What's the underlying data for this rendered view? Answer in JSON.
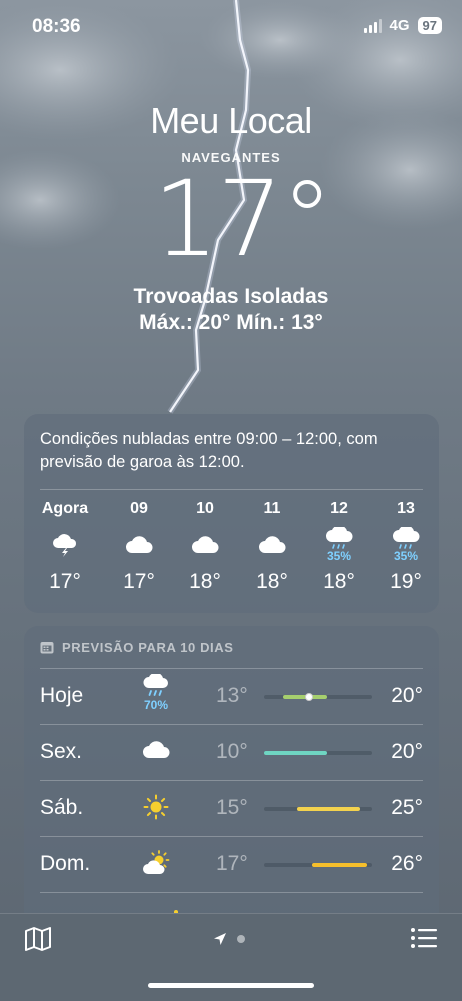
{
  "status": {
    "time": "08:36",
    "network": "4G",
    "battery": "97"
  },
  "location": {
    "title": "Meu Local",
    "city": "NAVEGANTES"
  },
  "current": {
    "temperature": "17°",
    "condition": "Trovoadas Isoladas",
    "hilo": "Máx.: 20°  Mín.: 13°"
  },
  "hourly": {
    "summary": "Condições nubladas entre 09:00 – 12:00, com previsão de garoa às 12:00.",
    "items": [
      {
        "label": "Agora",
        "icon": "thunder-cloud-icon",
        "precip": "",
        "temp": "17°"
      },
      {
        "label": "09",
        "icon": "cloud-icon",
        "precip": "",
        "temp": "17°"
      },
      {
        "label": "10",
        "icon": "cloud-icon",
        "precip": "",
        "temp": "18°"
      },
      {
        "label": "11",
        "icon": "cloud-icon",
        "precip": "",
        "temp": "18°"
      },
      {
        "label": "12",
        "icon": "drizzle-icon",
        "precip": "35%",
        "temp": "18°"
      },
      {
        "label": "13",
        "icon": "drizzle-icon",
        "precip": "35%",
        "temp": "19°"
      }
    ]
  },
  "daily": {
    "header": "PREVISÃO PARA 10 DIAS",
    "rows": [
      {
        "day": "Hoje",
        "icon": "rain-cloud-icon",
        "precip": "70%",
        "low": "13°",
        "high": "20°",
        "range_start": 0.18,
        "range_end": 0.58,
        "current_pos": 0.41,
        "bar_color": "#a6cf6e"
      },
      {
        "day": "Sex.",
        "icon": "cloud-icon",
        "precip": "",
        "low": "10°",
        "high": "20°",
        "range_start": 0.0,
        "range_end": 0.58,
        "bar_color": "#6fd5c2"
      },
      {
        "day": "Sáb.",
        "icon": "sun-icon",
        "precip": "",
        "low": "15°",
        "high": "25°",
        "range_start": 0.31,
        "range_end": 0.89,
        "bar_color": "#f3d24e"
      },
      {
        "day": "Dom.",
        "icon": "partly-cloudy-icon",
        "precip": "",
        "low": "17°",
        "high": "26°",
        "range_start": 0.44,
        "range_end": 0.95,
        "bar_color": "#f6bf2c"
      }
    ]
  },
  "tabbar": {
    "map": "map-icon",
    "location": "location-arrow-icon",
    "list": "list-icon"
  }
}
